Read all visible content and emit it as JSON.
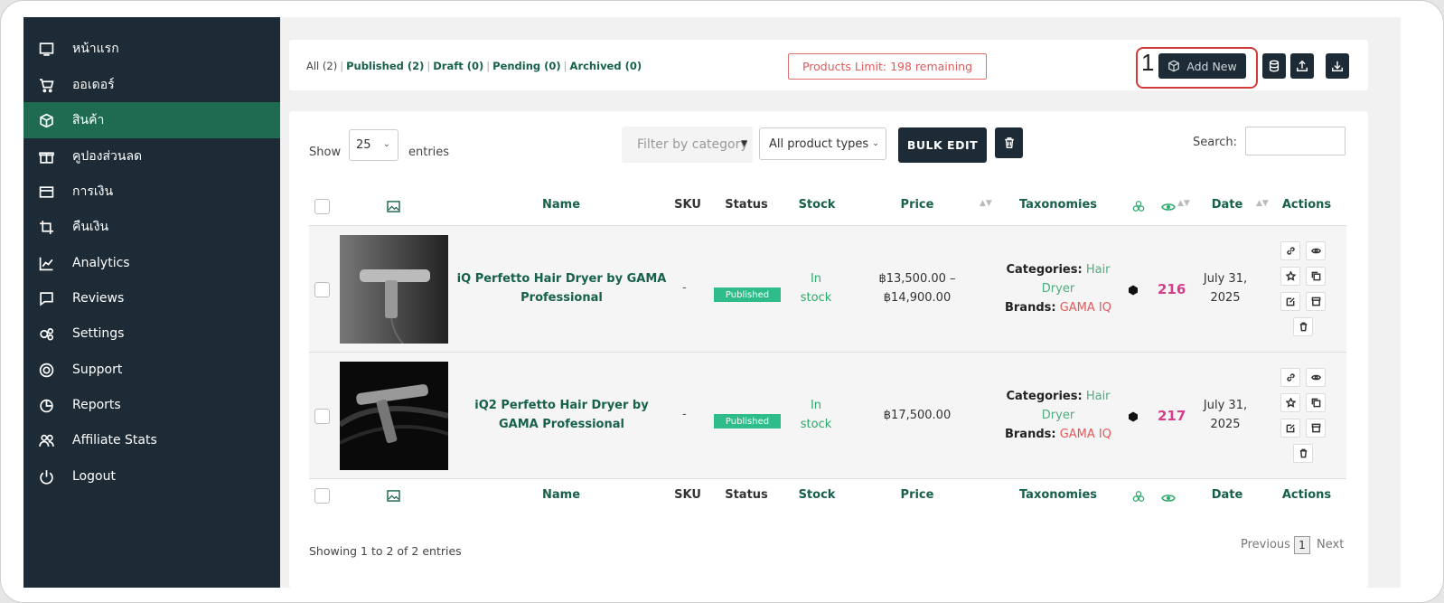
{
  "sidebar": {
    "items": [
      {
        "label": "หน้าแรก",
        "icon": "monitor-icon"
      },
      {
        "label": "ออเดอร์",
        "icon": "cart-icon"
      },
      {
        "label": "สินค้า",
        "icon": "box-icon",
        "active": true
      },
      {
        "label": "คูปองส่วนลด",
        "icon": "gift-icon"
      },
      {
        "label": "การเงิน",
        "icon": "card-icon"
      },
      {
        "label": "คืนเงิน",
        "icon": "refund-icon"
      },
      {
        "label": "Analytics",
        "icon": "chart-icon"
      },
      {
        "label": "Reviews",
        "icon": "chat-icon"
      },
      {
        "label": "Settings",
        "icon": "gears-icon"
      },
      {
        "label": "Support",
        "icon": "lifebuoy-icon"
      },
      {
        "label": "Reports",
        "icon": "pie-icon"
      },
      {
        "label": "Affiliate Stats",
        "icon": "users-icon"
      },
      {
        "label": "Logout",
        "icon": "power-icon"
      }
    ]
  },
  "topbar": {
    "filters": [
      {
        "label": "All (2)",
        "current": true
      },
      {
        "label": "Published (2)"
      },
      {
        "label": "Draft (0)"
      },
      {
        "label": "Pending (0)"
      },
      {
        "label": "Archived (0)"
      }
    ],
    "limit": "Products Limit: 198 remaining",
    "callout_number": "1",
    "add_new": "Add New"
  },
  "controls": {
    "show": "Show",
    "entries_value": "25",
    "entries": "entries",
    "category_placeholder": "Filter by category",
    "product_type": "All product types",
    "bulk_edit": "BULK EDIT",
    "search_label": "Search:"
  },
  "table": {
    "headers": {
      "name": "Name",
      "sku": "SKU",
      "status": "Status",
      "stock": "Stock",
      "price": "Price",
      "taxonomies": "Taxonomies",
      "date": "Date",
      "actions": "Actions"
    },
    "rows": [
      {
        "name": "iQ Perfetto Hair Dryer by GAMA Professional",
        "sku": "-",
        "status": "Published",
        "stock_line1": "In",
        "stock_line2": "stock",
        "price_line1": "฿13,500.00 –",
        "price_line2": "฿14,900.00",
        "cat_label": "Categories",
        "cat_value_1": "Hair",
        "cat_value_2": "Dryer",
        "brand_label": "Brands",
        "brand_value": "GAMA IQ",
        "views": "216",
        "date_line1": "July 31,",
        "date_line2": "2025"
      },
      {
        "name": "iQ2 Perfetto Hair Dryer by GAMA Professional",
        "sku": "-",
        "status": "Published",
        "stock_line1": "In",
        "stock_line2": "stock",
        "price_line1": "฿17,500.00",
        "price_line2": "",
        "cat_label": "Categories",
        "cat_value_1": "Hair",
        "cat_value_2": "Dryer",
        "brand_label": "Brands",
        "brand_value": "GAMA IQ",
        "views": "217",
        "date_line1": "July 31,",
        "date_line2": "2025"
      }
    ]
  },
  "footer": {
    "showing": "Showing 1 to 2 of 2 entries",
    "previous": "Previous",
    "page": "1",
    "next": "Next"
  },
  "colors": {
    "sidebar": "#1d2b36",
    "active": "#1f6b52",
    "accent_green": "#17604b",
    "badge": "#2ebd8a",
    "views": "#d63d8a",
    "limit": "#e05a5a"
  }
}
